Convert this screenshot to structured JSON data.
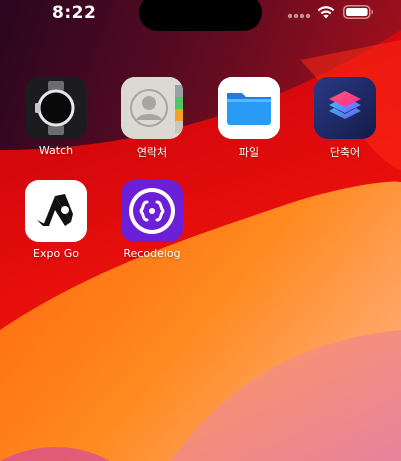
{
  "status_bar": {
    "time": "8:22",
    "signal": "signal-dots-icon",
    "wifi": "wifi-icon",
    "battery": "battery-icon"
  },
  "wallpaper": {
    "colors": [
      "#3a0a2a",
      "#8b0a14",
      "#e5000f",
      "#ff7a1a",
      "#ffb07a",
      "#d45a8e"
    ]
  },
  "apps": [
    {
      "label": "Watch",
      "icon": "watch-icon",
      "bg": "#1c1c1e"
    },
    {
      "label": "연락처",
      "icon": "contacts-icon",
      "bg": "#d9d6cf"
    },
    {
      "label": "파일",
      "icon": "files-folder-icon",
      "bg": "#ffffff"
    },
    {
      "label": "단축어",
      "icon": "shortcuts-icon",
      "bg": "#1f2a6b"
    },
    {
      "label": "Expo Go",
      "icon": "expo-go-icon",
      "bg": "#ffffff"
    },
    {
      "label": "Recodelog",
      "icon": "recodelog-icon",
      "bg": "#6b1fd6"
    }
  ]
}
